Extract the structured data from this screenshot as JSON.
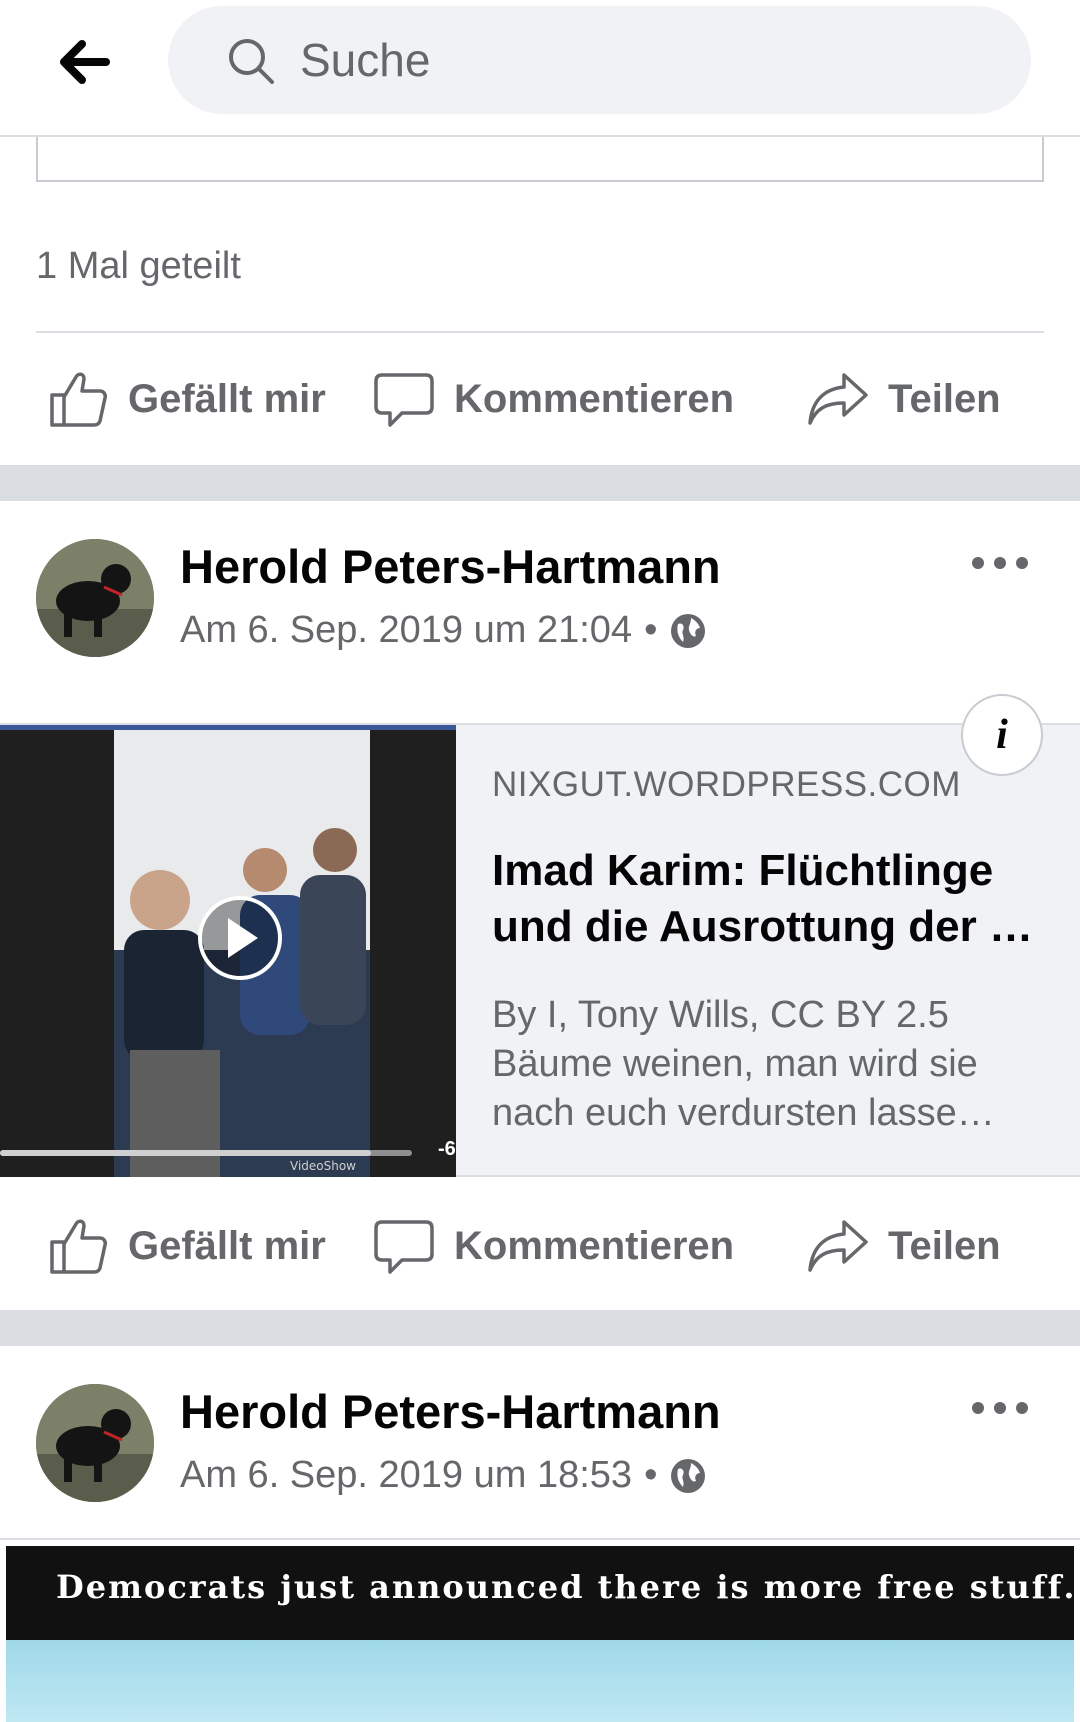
{
  "search": {
    "placeholder": "Suche"
  },
  "post1": {
    "shares": "1 Mal geteilt"
  },
  "actions": {
    "like": "Gefällt mir",
    "comment": "Kommentieren",
    "share": "Teilen"
  },
  "post2": {
    "author": "Herold Peters-Hartmann",
    "timestamp": "Am 6. Sep. 2019 um 21:04",
    "separator": "•",
    "link": {
      "domain": "NIXGUT.WORDPRESS.COM",
      "title_line1": "Imad Karim: Flüchtlinge",
      "title_line2": "und die Ausrottung der …",
      "desc_line1": "By I, Tony Wills, CC BY 2.5",
      "desc_line2": "Bäume weinen, man wird sie",
      "desc_line3": "nach euch verdursten lasse…",
      "info_label": "i",
      "video_time": "-6",
      "video_watermark": "VideoShow",
      "video_progress": 0.9
    }
  },
  "post3": {
    "author": "Herold Peters-Hartmann",
    "timestamp": "Am 6. Sep. 2019 um 18:53",
    "separator": "•",
    "image_caption": "Democrats just announced there is more free stuff…"
  },
  "colors": {
    "secondary_text": "#65676b",
    "separator": "#dadde1",
    "search_bg": "#f0f2f5",
    "video_bar_accent": "#3b5998"
  }
}
